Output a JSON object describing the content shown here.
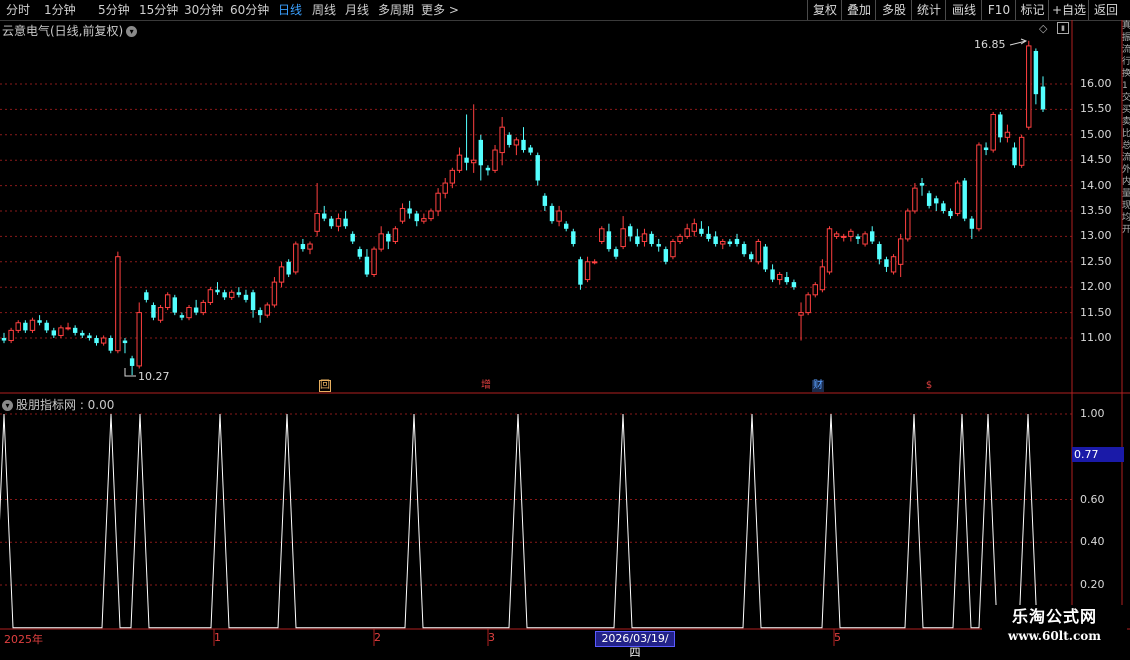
{
  "toolbar": {
    "periods": [
      "分时",
      "1分钟",
      "5分钟",
      "15分钟",
      "30分钟",
      "60分钟",
      "日线",
      "周线",
      "月线",
      "多周期",
      "更多 >"
    ],
    "active_period": "日线",
    "buttons": [
      "复权",
      "叠加",
      "多股",
      "统计",
      "画线",
      "F10",
      "标记",
      "+自选",
      "返回"
    ]
  },
  "main_panel": {
    "title": "云意电气(日线,前复权)",
    "y_ticks": [
      "16.00",
      "15.50",
      "15.00",
      "14.50",
      "14.00",
      "13.50",
      "13.00",
      "12.50",
      "12.00",
      "11.50",
      "11.00"
    ],
    "high_label": "16.85",
    "low_label": "10.27",
    "event_markers": [
      {
        "text": "回",
        "color": "#e8b060"
      },
      {
        "text": "增",
        "color": "#e04040"
      },
      {
        "text": "财",
        "color": "#5aa0ff"
      },
      {
        "text": "$",
        "color": "#e04040"
      }
    ]
  },
  "indicator_panel": {
    "title": "股朋指标网 : 0.00",
    "y_ticks": [
      "1.00",
      "0.60",
      "0.40",
      "0.20"
    ],
    "cursor_value": "0.77"
  },
  "x_axis": {
    "labels": [
      "2025年",
      "1",
      "2",
      "3",
      "5"
    ],
    "cursor_date": "2026/03/19/四"
  },
  "right_strip": [
    "真",
    "振",
    "流",
    "行",
    "换",
    "1",
    "交",
    "买",
    "卖",
    "比",
    "总",
    "流",
    "外",
    "内",
    "量",
    "现",
    "均",
    "开"
  ],
  "watermark": {
    "title": "乐淘公式网",
    "url": "www.60lt.com"
  },
  "colors": {
    "up": "#ff4040",
    "down": "#54ffff",
    "grid": "#8a1a1a",
    "indicator_line": "#ffffff",
    "active": "#3aa0ff"
  },
  "chart_data": [
    {
      "type": "candlestick",
      "title": "云意电气(日线,前复权)",
      "ylim": [
        10.2,
        17.3
      ],
      "y_ticks": [
        11.0,
        11.5,
        12.0,
        12.5,
        13.0,
        13.5,
        14.0,
        14.5,
        15.0,
        15.5,
        16.0
      ],
      "ohlc": [
        [
          11.0,
          11.1,
          10.9,
          10.95
        ],
        [
          10.95,
          11.2,
          10.9,
          11.15
        ],
        [
          11.15,
          11.35,
          11.1,
          11.3
        ],
        [
          11.3,
          11.35,
          11.1,
          11.15
        ],
        [
          11.15,
          11.4,
          11.1,
          11.35
        ],
        [
          11.35,
          11.45,
          11.25,
          11.3
        ],
        [
          11.3,
          11.35,
          11.1,
          11.15
        ],
        [
          11.15,
          11.2,
          11.0,
          11.05
        ],
        [
          11.05,
          11.25,
          11.0,
          11.2
        ],
        [
          11.2,
          11.3,
          11.15,
          11.2
        ],
        [
          11.2,
          11.25,
          11.05,
          11.1
        ],
        [
          11.1,
          11.15,
          11.0,
          11.05
        ],
        [
          11.05,
          11.1,
          10.95,
          11.0
        ],
        [
          11.0,
          11.05,
          10.85,
          10.9
        ],
        [
          10.9,
          11.05,
          10.85,
          11.0
        ],
        [
          11.0,
          11.05,
          10.7,
          10.75
        ],
        [
          10.75,
          12.7,
          10.7,
          12.6
        ],
        [
          10.95,
          11.0,
          10.7,
          10.9
        ],
        [
          10.6,
          10.65,
          10.27,
          10.45
        ],
        [
          10.45,
          11.7,
          10.4,
          11.5
        ],
        [
          11.9,
          11.95,
          11.7,
          11.75
        ],
        [
          11.65,
          11.7,
          11.35,
          11.4
        ],
        [
          11.35,
          11.65,
          11.3,
          11.6
        ],
        [
          11.6,
          11.9,
          11.55,
          11.85
        ],
        [
          11.8,
          11.85,
          11.45,
          11.5
        ],
        [
          11.45,
          11.5,
          11.35,
          11.4
        ],
        [
          11.4,
          11.65,
          11.35,
          11.6
        ],
        [
          11.6,
          11.75,
          11.45,
          11.5
        ],
        [
          11.5,
          11.75,
          11.45,
          11.7
        ],
        [
          11.7,
          12.0,
          11.65,
          11.95
        ],
        [
          11.95,
          12.1,
          11.85,
          11.9
        ],
        [
          11.9,
          11.95,
          11.75,
          11.8
        ],
        [
          11.8,
          11.95,
          11.75,
          11.9
        ],
        [
          11.9,
          12.0,
          11.8,
          11.85
        ],
        [
          11.85,
          11.95,
          11.7,
          11.75
        ],
        [
          11.9,
          11.95,
          11.4,
          11.55
        ],
        [
          11.55,
          11.6,
          11.3,
          11.45
        ],
        [
          11.45,
          11.7,
          11.4,
          11.65
        ],
        [
          11.65,
          12.2,
          11.6,
          12.1
        ],
        [
          12.1,
          12.5,
          12.0,
          12.4
        ],
        [
          12.5,
          12.55,
          12.2,
          12.25
        ],
        [
          12.3,
          12.9,
          12.25,
          12.85
        ],
        [
          12.85,
          12.95,
          12.7,
          12.75
        ],
        [
          12.75,
          12.9,
          12.65,
          12.85
        ],
        [
          13.1,
          14.05,
          13.0,
          13.45
        ],
        [
          13.45,
          13.6,
          13.3,
          13.35
        ],
        [
          13.35,
          13.4,
          13.15,
          13.2
        ],
        [
          13.2,
          13.45,
          13.1,
          13.35
        ],
        [
          13.35,
          13.5,
          13.15,
          13.2
        ],
        [
          13.05,
          13.1,
          12.85,
          12.9
        ],
        [
          12.75,
          12.8,
          12.55,
          12.6
        ],
        [
          12.6,
          12.75,
          12.2,
          12.25
        ],
        [
          12.25,
          12.8,
          12.2,
          12.75
        ],
        [
          12.75,
          13.2,
          12.7,
          13.05
        ],
        [
          13.05,
          13.1,
          12.75,
          12.9
        ],
        [
          12.9,
          13.2,
          12.85,
          13.15
        ],
        [
          13.3,
          13.65,
          13.25,
          13.55
        ],
        [
          13.55,
          13.7,
          13.35,
          13.45
        ],
        [
          13.45,
          13.5,
          13.2,
          13.3
        ],
        [
          13.3,
          13.45,
          13.25,
          13.35
        ],
        [
          13.35,
          13.55,
          13.3,
          13.5
        ],
        [
          13.5,
          13.95,
          13.4,
          13.85
        ],
        [
          13.85,
          14.15,
          13.75,
          14.05
        ],
        [
          14.05,
          14.35,
          13.95,
          14.3
        ],
        [
          14.3,
          14.75,
          14.25,
          14.6
        ],
        [
          14.55,
          15.4,
          14.3,
          14.45
        ],
        [
          14.45,
          15.6,
          14.25,
          14.5
        ],
        [
          14.9,
          15.0,
          14.1,
          14.4
        ],
        [
          14.35,
          14.4,
          14.2,
          14.3
        ],
        [
          14.3,
          14.8,
          14.25,
          14.7
        ],
        [
          14.65,
          15.35,
          14.4,
          15.15
        ],
        [
          15.0,
          15.05,
          14.75,
          14.8
        ],
        [
          14.8,
          14.95,
          14.6,
          14.9
        ],
        [
          14.9,
          15.15,
          14.65,
          14.7
        ],
        [
          14.75,
          14.8,
          14.6,
          14.65
        ],
        [
          14.6,
          14.65,
          14.0,
          14.1
        ],
        [
          13.8,
          13.85,
          13.5,
          13.6
        ],
        [
          13.6,
          13.65,
          13.25,
          13.3
        ],
        [
          13.3,
          13.6,
          13.2,
          13.5
        ],
        [
          13.25,
          13.3,
          13.1,
          13.15
        ],
        [
          13.1,
          13.15,
          12.8,
          12.85
        ],
        [
          12.55,
          12.6,
          11.95,
          12.05
        ],
        [
          12.15,
          12.6,
          12.1,
          12.5
        ],
        [
          12.5,
          12.55,
          12.45,
          12.5
        ],
        [
          12.9,
          13.2,
          12.85,
          13.15
        ],
        [
          13.1,
          13.25,
          12.7,
          12.75
        ],
        [
          12.75,
          12.8,
          12.55,
          12.6
        ],
        [
          12.8,
          13.4,
          12.75,
          13.15
        ],
        [
          13.2,
          13.25,
          12.9,
          13.0
        ],
        [
          13.0,
          13.15,
          12.8,
          12.85
        ],
        [
          12.9,
          13.15,
          12.8,
          13.05
        ],
        [
          13.05,
          13.1,
          12.8,
          12.85
        ],
        [
          12.85,
          12.95,
          12.7,
          12.8
        ],
        [
          12.75,
          12.8,
          12.45,
          12.5
        ],
        [
          12.6,
          12.95,
          12.55,
          12.9
        ],
        [
          12.9,
          13.05,
          12.85,
          13.0
        ],
        [
          13.0,
          13.25,
          12.95,
          13.15
        ],
        [
          13.1,
          13.35,
          13.0,
          13.25
        ],
        [
          13.15,
          13.3,
          13.0,
          13.05
        ],
        [
          13.05,
          13.2,
          12.9,
          12.95
        ],
        [
          13.0,
          13.1,
          12.8,
          12.85
        ],
        [
          12.85,
          12.95,
          12.75,
          12.9
        ],
        [
          12.9,
          12.95,
          12.8,
          12.85
        ],
        [
          12.95,
          13.05,
          12.8,
          12.85
        ],
        [
          12.85,
          12.9,
          12.6,
          12.65
        ],
        [
          12.65,
          12.7,
          12.5,
          12.55
        ],
        [
          12.5,
          12.95,
          12.45,
          12.9
        ],
        [
          12.8,
          12.85,
          12.3,
          12.35
        ],
        [
          12.35,
          12.45,
          12.1,
          12.15
        ],
        [
          12.15,
          12.3,
          12.05,
          12.25
        ],
        [
          12.2,
          12.3,
          12.05,
          12.1
        ],
        [
          12.1,
          12.15,
          11.95,
          12.0
        ],
        [
          11.45,
          11.7,
          10.95,
          11.5
        ],
        [
          11.5,
          11.9,
          11.45,
          11.85
        ],
        [
          11.85,
          12.1,
          11.8,
          12.05
        ],
        [
          11.95,
          12.55,
          11.9,
          12.4
        ],
        [
          12.3,
          13.2,
          12.25,
          13.15
        ],
        [
          13.0,
          13.1,
          12.95,
          13.05
        ],
        [
          13.0,
          13.05,
          12.9,
          13.0
        ],
        [
          13.0,
          13.15,
          12.9,
          13.1
        ],
        [
          13.0,
          13.05,
          12.85,
          12.95
        ],
        [
          12.85,
          13.1,
          12.8,
          13.05
        ],
        [
          13.1,
          13.2,
          12.85,
          12.9
        ],
        [
          12.85,
          12.9,
          12.45,
          12.55
        ],
        [
          12.55,
          12.6,
          12.3,
          12.4
        ],
        [
          12.3,
          12.65,
          12.25,
          12.6
        ],
        [
          12.45,
          13.05,
          12.2,
          12.95
        ],
        [
          12.95,
          13.55,
          12.9,
          13.5
        ],
        [
          13.5,
          14.05,
          13.45,
          13.95
        ],
        [
          14.05,
          14.15,
          13.8,
          14.0
        ],
        [
          13.85,
          13.9,
          13.55,
          13.6
        ],
        [
          13.75,
          13.8,
          13.5,
          13.65
        ],
        [
          13.65,
          13.7,
          13.45,
          13.5
        ],
        [
          13.5,
          13.55,
          13.35,
          13.4
        ],
        [
          13.45,
          14.1,
          13.4,
          14.05
        ],
        [
          14.1,
          14.15,
          13.3,
          13.35
        ],
        [
          13.35,
          13.4,
          12.95,
          13.15
        ],
        [
          13.15,
          14.85,
          13.1,
          14.8
        ],
        [
          14.75,
          14.85,
          14.6,
          14.7
        ],
        [
          14.7,
          15.45,
          14.65,
          15.4
        ],
        [
          15.4,
          15.45,
          14.85,
          14.95
        ],
        [
          14.95,
          15.2,
          14.85,
          15.05
        ],
        [
          14.75,
          14.85,
          14.35,
          14.4
        ],
        [
          14.4,
          15.0,
          14.35,
          14.95
        ],
        [
          15.15,
          16.85,
          15.1,
          16.75
        ],
        [
          16.65,
          16.7,
          15.6,
          15.8
        ],
        [
          15.95,
          16.15,
          15.45,
          15.5
        ]
      ]
    },
    {
      "type": "line",
      "title": "股朋指标网",
      "ylim": [
        0,
        1.1
      ],
      "y_ticks": [
        0.2,
        0.4,
        0.6,
        1.0
      ],
      "baseline": 0,
      "peak_value": 1.0,
      "spike_positions": [
        4,
        111,
        140,
        220,
        287,
        414,
        518,
        623,
        752,
        831,
        914,
        962,
        988,
        1028
      ],
      "series": [
        {
          "values": [
            0
          ]
        }
      ]
    }
  ]
}
